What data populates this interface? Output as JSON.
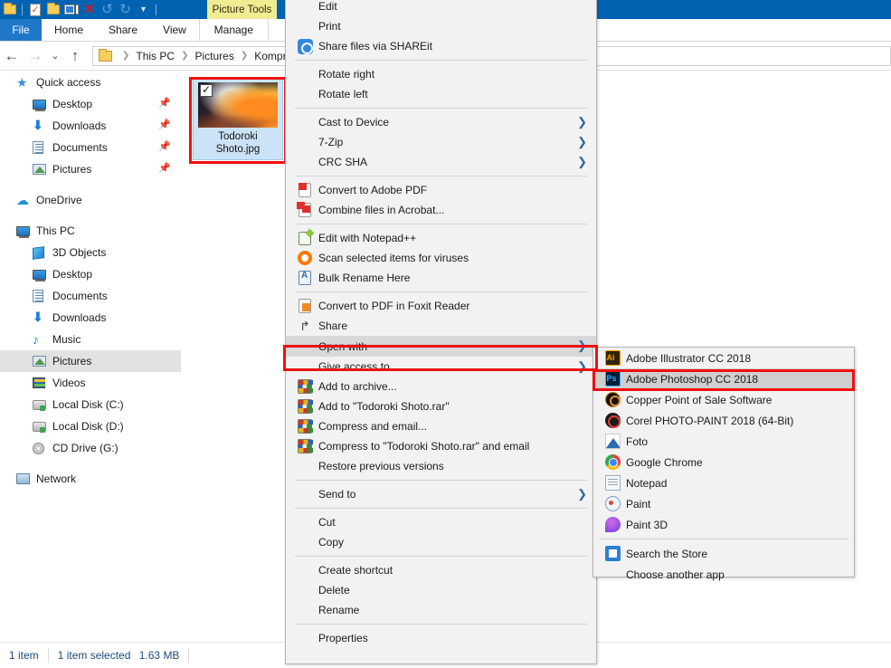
{
  "window": {
    "quick_access_toolbar": [
      {
        "name": "folder-icon",
        "glyph": "folder"
      },
      {
        "name": "properties-check-icon",
        "glyph": "doc-check"
      },
      {
        "name": "new-folder-icon",
        "glyph": "folder"
      },
      {
        "name": "rename-icon",
        "glyph": "rename"
      },
      {
        "name": "delete-icon",
        "glyph": "x"
      },
      {
        "name": "undo-icon",
        "glyph": "undo"
      },
      {
        "name": "redo-icon",
        "glyph": "redo"
      },
      {
        "name": "customize-qat-icon",
        "glyph": "caret"
      }
    ],
    "contextual_tab_title": "Picture Tools"
  },
  "ribbon": {
    "tabs": [
      {
        "label": "File",
        "active": false
      },
      {
        "label": "Home",
        "active": false
      },
      {
        "label": "Share",
        "active": false
      },
      {
        "label": "View",
        "active": false
      },
      {
        "label": "Manage",
        "active": false
      }
    ]
  },
  "address_bar": {
    "back_glyph": "←",
    "forward_glyph": "→",
    "recent_glyph": "⌄",
    "up_glyph": "↑",
    "breadcrumb": [
      "This PC",
      "Pictures",
      "Kompre"
    ]
  },
  "sidebar": {
    "items": [
      {
        "label": "Quick access",
        "icon": "star-icon",
        "indent": false,
        "pinned": false,
        "selected": false
      },
      {
        "label": "Desktop",
        "icon": "monitor-icon",
        "indent": true,
        "pinned": true,
        "selected": false
      },
      {
        "label": "Downloads",
        "icon": "download-icon",
        "indent": true,
        "pinned": true,
        "selected": false
      },
      {
        "label": "Documents",
        "icon": "document-icon",
        "indent": true,
        "pinned": true,
        "selected": false
      },
      {
        "label": "Pictures",
        "icon": "pictures-icon",
        "indent": true,
        "pinned": true,
        "selected": false
      },
      {
        "label": "OneDrive",
        "icon": "cloud-icon",
        "indent": false,
        "pinned": false,
        "selected": false,
        "gap_before": true
      },
      {
        "label": "This PC",
        "icon": "this-pc-icon",
        "indent": false,
        "pinned": false,
        "selected": false,
        "gap_before": true
      },
      {
        "label": "3D Objects",
        "icon": "3d-objects-icon",
        "indent": true,
        "pinned": false,
        "selected": false
      },
      {
        "label": "Desktop",
        "icon": "monitor-icon",
        "indent": true,
        "pinned": false,
        "selected": false
      },
      {
        "label": "Documents",
        "icon": "document-icon",
        "indent": true,
        "pinned": false,
        "selected": false
      },
      {
        "label": "Downloads",
        "icon": "download-icon",
        "indent": true,
        "pinned": false,
        "selected": false
      },
      {
        "label": "Music",
        "icon": "music-icon",
        "indent": true,
        "pinned": false,
        "selected": false
      },
      {
        "label": "Pictures",
        "icon": "pictures-icon",
        "indent": true,
        "pinned": false,
        "selected": true
      },
      {
        "label": "Videos",
        "icon": "videos-icon",
        "indent": true,
        "pinned": false,
        "selected": false
      },
      {
        "label": "Local Disk (C:)",
        "icon": "disk-icon",
        "indent": true,
        "pinned": false,
        "selected": false
      },
      {
        "label": "Local Disk (D:)",
        "icon": "disk-icon",
        "indent": true,
        "pinned": false,
        "selected": false
      },
      {
        "label": "CD Drive (G:)",
        "icon": "cd-drive-icon",
        "indent": true,
        "pinned": false,
        "selected": false
      },
      {
        "label": "Network",
        "icon": "network-icon",
        "indent": false,
        "pinned": false,
        "selected": false,
        "gap_before": true
      }
    ]
  },
  "content": {
    "file": {
      "name_line1": "Todoroki",
      "name_line2": "Shoto.jpg",
      "selected": true,
      "checked": true
    }
  },
  "context_menu": {
    "items": [
      {
        "label": "Edit",
        "icon": null,
        "arrow": false
      },
      {
        "label": "Print",
        "icon": null,
        "arrow": false
      },
      {
        "label": "Share files via SHAREit",
        "icon": "shareit-icon",
        "arrow": false
      },
      {
        "separator_after": true
      },
      {
        "label": "Rotate right",
        "icon": null,
        "arrow": false
      },
      {
        "label": "Rotate left",
        "icon": null,
        "arrow": false
      },
      {
        "separator_after": true
      },
      {
        "label": "Cast to Device",
        "icon": null,
        "arrow": true
      },
      {
        "label": "7-Zip",
        "icon": null,
        "arrow": true
      },
      {
        "label": "CRC SHA",
        "icon": null,
        "arrow": true
      },
      {
        "separator_after": true
      },
      {
        "label": "Convert to Adobe PDF",
        "icon": "adobe-pdf-icon",
        "arrow": false
      },
      {
        "label": "Combine files in Acrobat...",
        "icon": "acrobat-combine-icon",
        "arrow": false
      },
      {
        "separator_after": true
      },
      {
        "label": "Edit with Notepad++",
        "icon": "notepadpp-icon",
        "arrow": false
      },
      {
        "label": "Scan selected items for viruses",
        "icon": "avast-icon",
        "arrow": false
      },
      {
        "label": "Bulk Rename Here",
        "icon": "bulk-rename-icon",
        "arrow": false
      },
      {
        "separator_after": true
      },
      {
        "label": "Convert to PDF in Foxit Reader",
        "icon": "foxit-icon",
        "arrow": false
      },
      {
        "label": "Share",
        "icon": "share-icon",
        "arrow": false
      },
      {
        "label": "Open with",
        "icon": null,
        "arrow": true,
        "highlighted": true,
        "outlined": true
      },
      {
        "label": "Give access to",
        "icon": null,
        "arrow": true
      },
      {
        "label": "Add to archive...",
        "icon": "winrar-icon",
        "arrow": false
      },
      {
        "label": "Add to \"Todoroki Shoto.rar\"",
        "icon": "winrar-icon",
        "arrow": false
      },
      {
        "label": "Compress and email...",
        "icon": "winrar-icon",
        "arrow": false
      },
      {
        "label": "Compress to \"Todoroki Shoto.rar\" and email",
        "icon": "winrar-icon",
        "arrow": false
      },
      {
        "label": "Restore previous versions",
        "icon": null,
        "arrow": false
      },
      {
        "separator_after": true
      },
      {
        "label": "Send to",
        "icon": null,
        "arrow": true
      },
      {
        "separator_after": true
      },
      {
        "label": "Cut",
        "icon": null,
        "arrow": false
      },
      {
        "label": "Copy",
        "icon": null,
        "arrow": false
      },
      {
        "separator_after": true
      },
      {
        "label": "Create shortcut",
        "icon": null,
        "arrow": false
      },
      {
        "label": "Delete",
        "icon": null,
        "arrow": false
      },
      {
        "label": "Rename",
        "icon": null,
        "arrow": false
      },
      {
        "separator_after": true
      },
      {
        "label": "Properties",
        "icon": null,
        "arrow": false
      }
    ]
  },
  "open_with_submenu": {
    "items": [
      {
        "label": "Adobe Illustrator CC 2018",
        "icon": "adobe-illustrator-icon",
        "highlighted": false
      },
      {
        "label": "Adobe Photoshop CC 2018",
        "icon": "adobe-photoshop-icon",
        "highlighted": true,
        "outlined": true
      },
      {
        "label": "Copper Point of Sale Software",
        "icon": "copper-pos-icon",
        "highlighted": false
      },
      {
        "label": "Corel PHOTO-PAINT 2018 (64-Bit)",
        "icon": "corel-photopaint-icon",
        "highlighted": false
      },
      {
        "label": "Foto",
        "icon": "foto-icon",
        "highlighted": false
      },
      {
        "label": "Google Chrome",
        "icon": "google-chrome-icon",
        "highlighted": false
      },
      {
        "label": "Notepad",
        "icon": "notepad-icon",
        "highlighted": false
      },
      {
        "label": "Paint",
        "icon": "paint-icon",
        "highlighted": false
      },
      {
        "label": "Paint 3D",
        "icon": "paint-3d-icon",
        "highlighted": false
      },
      {
        "separator_after": true
      },
      {
        "label": "Search the Store",
        "icon": "store-icon",
        "highlighted": false
      },
      {
        "label": "Choose another app",
        "icon": null,
        "highlighted": false
      }
    ]
  },
  "status_bar": {
    "item_count": "1 item",
    "selection": "1 item selected",
    "size": "1.63 MB"
  },
  "colors": {
    "titlebar": "#0063b1",
    "file_tab": "#1f77c9",
    "contextual_tab": "#f0ec92",
    "highlight_red": "#ef1010",
    "menu_bg": "#f2f2f2",
    "menu_highlight": "#d8d8d8",
    "selection_blue": "#cce3f7",
    "status_text": "#1b4a7a"
  }
}
